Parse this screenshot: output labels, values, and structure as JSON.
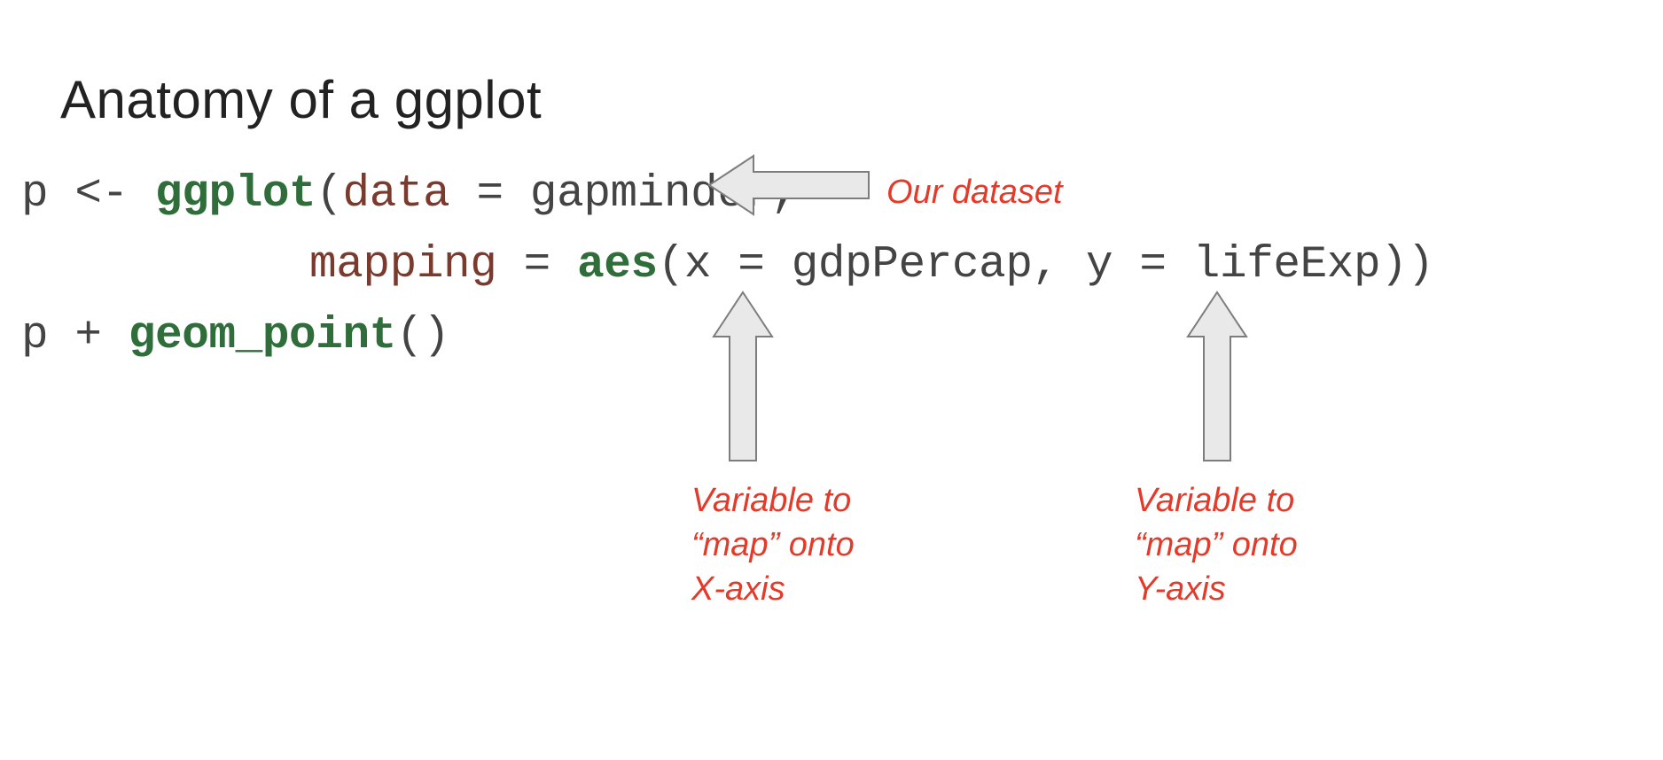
{
  "title": "Anatomy of a ggplot",
  "code": {
    "l1_a": "p <- ",
    "l1_fn": "ggplot",
    "l1_b": "(",
    "l1_arg1": "data",
    "l1_c": " = gapminder,",
    "l2_pad": "",
    "l2_arg2": "mapping",
    "l2_a": " = ",
    "l2_fn": "aes",
    "l2_b": "(x = gdpPercap, y = lifeExp))",
    "l3_a": "p + ",
    "l3_fn": "geom_point",
    "l3_b": "()"
  },
  "annotations": {
    "dataset": "Our dataset",
    "xline1": "Variable to",
    "xline2": "“map” onto",
    "xline3": "X-axis",
    "yline1": "Variable to",
    "yline2": "“map” onto",
    "yline3": "Y-axis"
  },
  "arrows": {
    "fill": "#e9e9e9",
    "stroke": "#7d7d7d"
  }
}
